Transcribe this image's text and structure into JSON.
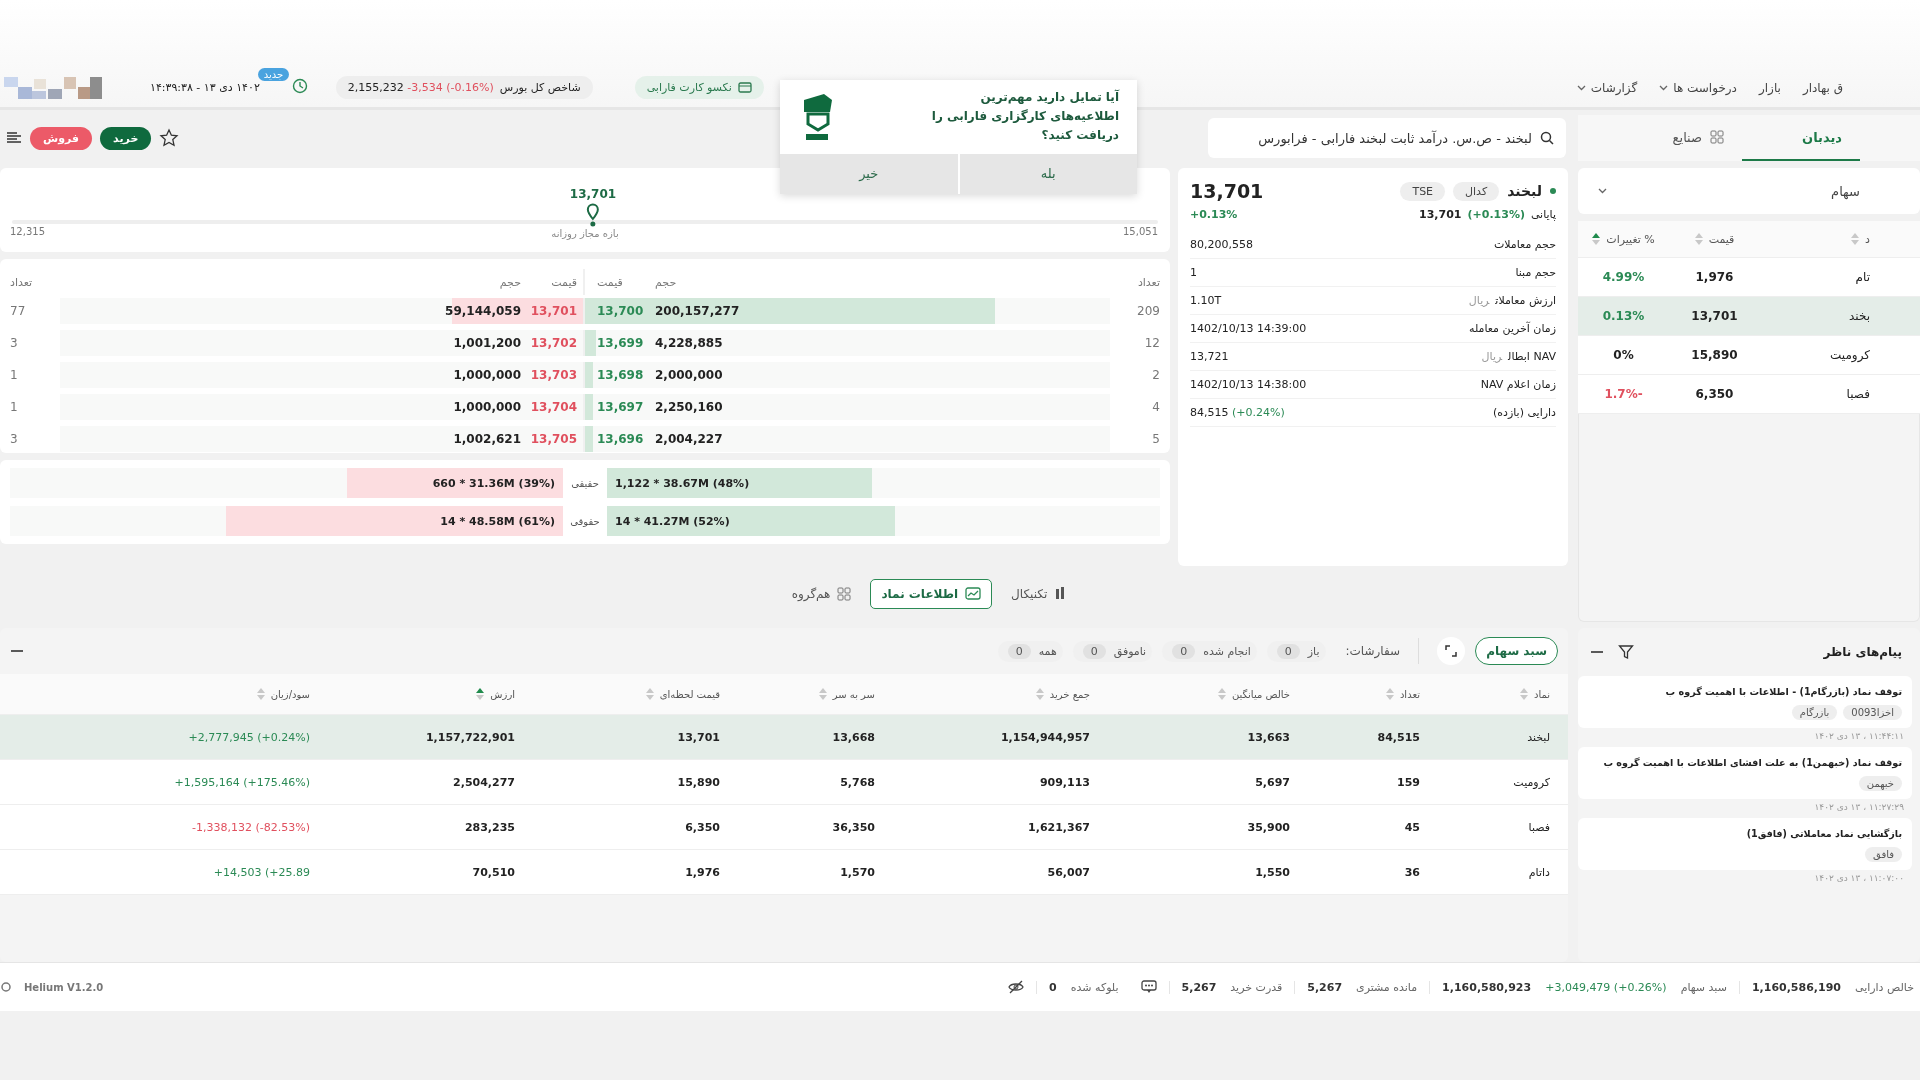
{
  "header": {
    "nav": [
      {
        "label": "ق بهادار",
        "dropdown": false
      },
      {
        "label": "بازار",
        "dropdown": false
      },
      {
        "label": "درخواست ها",
        "dropdown": true
      },
      {
        "label": "گزارشات",
        "dropdown": true
      }
    ],
    "card_chip": "نکسو کارت فارابی",
    "index": {
      "label": "شاخص کل بورس",
      "value": "2,155,232",
      "change": "-3,534 (-0.16%)"
    },
    "new_badge": "جدید",
    "datetime": "۱۴۰۲ دی ۱۳ - ۱۴:۳۹:۳۸"
  },
  "notification": {
    "message": "آیا تمایل دارید مهم‌ترین اطلاعیه‌های کارگزاری فارابی را دریافت کنید؟",
    "buttons": [
      "بله",
      "خیر"
    ]
  },
  "toolbar": {
    "buy": "خرید",
    "sell": "فروش",
    "search": {
      "value": "لبخند - ص.س. درآمد ثابت لبخند فارابی - فرابورس"
    }
  },
  "side_tabs": [
    {
      "label": "دیدبان",
      "selected": true
    },
    {
      "label": "صنایع",
      "selected": false
    }
  ],
  "watchlist": {
    "group": "سهام",
    "columns": [
      {
        "label": "د",
        "sorted": false
      },
      {
        "label": "قیمت",
        "sorted": false
      },
      {
        "label": "% تغییرات",
        "sorted": true
      }
    ],
    "rows": [
      {
        "symbol": "تام",
        "price": "1,976",
        "change": "4.99%",
        "color": "#2b8a55",
        "selected": false
      },
      {
        "symbol": "بخند",
        "price": "13,701",
        "change": "0.13%",
        "color": "#2b8a55",
        "selected": true
      },
      {
        "symbol": "کرومیت",
        "price": "15,890",
        "change": "0%",
        "color": "#222222",
        "selected": false
      },
      {
        "symbol": "فصبا",
        "price": "6,350",
        "change": "-1.7%",
        "color": "#e0505e",
        "selected": false
      }
    ]
  },
  "symbol_info": {
    "symbol": "لبخند",
    "badges": [
      "کدال",
      "TSE"
    ],
    "price": "13,701",
    "change": "+0.13%",
    "closing": {
      "label": "پایانی",
      "percent": "(+0.13%)",
      "value": "13,701"
    },
    "rows": [
      {
        "label": "حجم معاملات",
        "value": "80,200,558"
      },
      {
        "label": "حجم مبنا",
        "value": "1"
      },
      {
        "label": "ارزش معاملات",
        "unit": "ریال",
        "value": "1.10T"
      },
      {
        "label": "زمان آخرین معامله",
        "value": "1402/10/13 14:39:00"
      },
      {
        "label": "NAV ابطال",
        "unit": "ریال",
        "value": "13,721"
      },
      {
        "label": "زمان اعلام NAV",
        "value": "1402/10/13 14:38:00"
      },
      {
        "label": "دارایی (بازده)",
        "value": "84,515",
        "change": "(+0.24%)"
      }
    ]
  },
  "price_range": {
    "price": "13,701",
    "level": 0.507,
    "min": "12,315",
    "max": "15,051",
    "label": "بازه مجاز روزانه"
  },
  "order_book": {
    "columns": [
      "تعداد",
      "حجم",
      "قیمت",
      "قیمت",
      "حجم",
      "تعداد"
    ],
    "rows": [
      {
        "sell": {
          "count": "77",
          "volume": "59,144,059",
          "price": "13,701",
          "level": 0.25
        },
        "buy": {
          "price": "13,700",
          "volume": "200,157,277",
          "count": "209",
          "level": 0.78
        }
      },
      {
        "sell": {
          "count": "3",
          "volume": "1,001,200",
          "price": "13,702"
        },
        "buy": {
          "price": "13,699",
          "volume": "4,228,885",
          "count": "12",
          "level": 0.02
        }
      },
      {
        "sell": {
          "count": "1",
          "volume": "1,000,000",
          "price": "13,703"
        },
        "buy": {
          "price": "13,698",
          "volume": "2,000,000",
          "count": "2",
          "level": 0.015
        }
      },
      {
        "sell": {
          "count": "1",
          "volume": "1,000,000",
          "price": "13,704"
        },
        "buy": {
          "price": "13,697",
          "volume": "2,250,160",
          "count": "4",
          "level": 0.015
        }
      },
      {
        "sell": {
          "count": "3",
          "volume": "1,002,621",
          "price": "13,705"
        },
        "buy": {
          "price": "13,696",
          "volume": "2,004,227",
          "count": "5",
          "level": 0.015
        }
      }
    ]
  },
  "investor_split": [
    {
      "label": "حقیقی",
      "buy": {
        "text": "1,122 * 38.67M (48%)",
        "level": 0.48
      },
      "sell": {
        "text": "660 * 31.36M (39%)",
        "level": 0.39
      }
    },
    {
      "label": "حقوقی",
      "buy": {
        "text": "14 * 41.27M (52%)",
        "level": 0.52
      },
      "sell": {
        "text": "14 * 48.58M (61%)",
        "level": 0.61
      }
    }
  ],
  "view_tabs": [
    {
      "label": "تکنیکال",
      "selected": false
    },
    {
      "label": "اطلاعات نماد",
      "selected": true
    },
    {
      "label": "هم‌گروه",
      "selected": false
    }
  ],
  "portfolio": {
    "tab": "سبد سهام",
    "orders_label": "سفارشات:",
    "filters": [
      {
        "label": "باز",
        "count": "0"
      },
      {
        "label": "انجام شده",
        "count": "0"
      },
      {
        "label": "ناموفق",
        "count": "0"
      },
      {
        "label": "همه",
        "count": "0"
      }
    ],
    "columns": [
      {
        "label": "نماد",
        "sorted": false
      },
      {
        "label": "تعداد",
        "sorted": false
      },
      {
        "label": "خالص میانگین",
        "sorted": false
      },
      {
        "label": "جمع خرید",
        "sorted": false
      },
      {
        "label": "سر به سر",
        "sorted": false
      },
      {
        "label": "قیمت لحظه‌ای",
        "sorted": false
      },
      {
        "label": "ارزش",
        "sorted": true
      },
      {
        "label": "سود/زیان",
        "sorted": false
      }
    ],
    "rows": [
      {
        "cells": [
          "لبخند",
          "84,515",
          "13,663",
          "1,154,944,957",
          "13,668",
          "13,701",
          "1,157,722,901"
        ],
        "pnl": "+2,777,945 (+0.24%)",
        "color": "#2b8a55",
        "selected": true
      },
      {
        "cells": [
          "کرومیت",
          "159",
          "5,697",
          "909,113",
          "5,768",
          "15,890",
          "2,504,277"
        ],
        "pnl": "+1,595,164 (+175.46%)",
        "color": "#2b8a55",
        "selected": false
      },
      {
        "cells": [
          "فصبا",
          "45",
          "35,900",
          "1,621,367",
          "36,350",
          "6,350",
          "283,235"
        ],
        "pnl": "-1,338,132 (-82.53%)",
        "color": "#e0505e",
        "selected": false
      },
      {
        "cells": [
          "داتام",
          "36",
          "1,550",
          "56,007",
          "1,570",
          "1,976",
          "70,510"
        ],
        "pnl": "+14,503 (+25.89",
        "color": "#2b8a55",
        "selected": false
      }
    ]
  },
  "messages": {
    "title": "پیام‌های ناظر",
    "items": [
      {
        "text": "توقف نماد (بازرگام1) - اطلاعات با اهمیت گروه ب",
        "tags": [
          "اخزا0093",
          "بازرگام"
        ],
        "time": "۱۱:۴۴:۱۱ ، ۱۳ دی ۱۴۰۲"
      },
      {
        "text": "توقف نماد (خبهمن1) به علت افشای اطلاعات با اهمیت گروه ب",
        "tags": [
          "خبهمن"
        ],
        "time": "۱۱:۲۷:۲۹ ، ۱۳ دی ۱۴۰۲"
      },
      {
        "text": "بازگشایی نماد معاملاتی (فافق1)",
        "tags": [
          "فافق"
        ],
        "time": "۱۱:۰۷:۰۰ ، ۱۳ دی ۱۴۰۲"
      }
    ]
  },
  "status_bar": {
    "items": [
      {
        "label": "خالص دارایی",
        "value": "1,160,586,190"
      },
      {
        "label": "سبد سهام",
        "change": "+3,049,479 (+0.26%)",
        "value": "1,160,580,923"
      },
      {
        "label": "مانده مشتری",
        "value": "5,267"
      },
      {
        "label": "قدرت خرید",
        "value": "5,267"
      },
      {
        "label": "بلوکه شده",
        "value": "0"
      }
    ],
    "version": "Helium V1.2.0"
  }
}
